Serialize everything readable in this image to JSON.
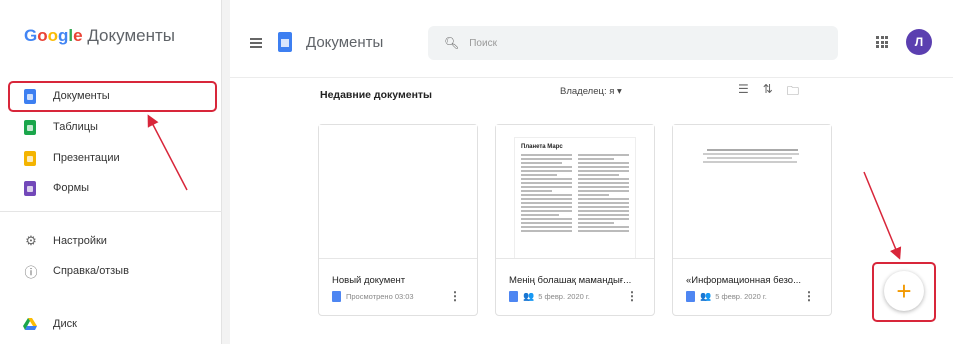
{
  "sidebar": {
    "logo_google": "Google",
    "logo_product": "Документы",
    "items": [
      {
        "label": "Документы",
        "color": "#3d7ff1"
      },
      {
        "label": "Таблицы",
        "color": "#1aa64b"
      },
      {
        "label": "Презентации",
        "color": "#f4b400"
      },
      {
        "label": "Формы",
        "color": "#7248b9"
      }
    ],
    "settings_label": "Настройки",
    "help_label": "Справка/отзыв",
    "drive_label": "Диск"
  },
  "header": {
    "app_title": "Документы",
    "search_placeholder": "Поиск",
    "avatar_letter": "Л"
  },
  "main": {
    "section_title": "Недавние документы",
    "owner_filter": "Владелец: я ▾",
    "cards": [
      {
        "title": "Новый документ",
        "meta": "Просмотрено 03:03"
      },
      {
        "title": "Менің болашақ мамандығ...",
        "meta": "5 февр. 2020 г."
      },
      {
        "title": "«Информационная безо...",
        "meta": "5 февр. 2020 г."
      }
    ],
    "doc_preview_heading": "Планета Марс"
  },
  "fab": {
    "label": "+"
  },
  "colors": {
    "highlight": "#d8263a",
    "accent": "#3d7ff1",
    "fab_plus": "#f29900"
  }
}
